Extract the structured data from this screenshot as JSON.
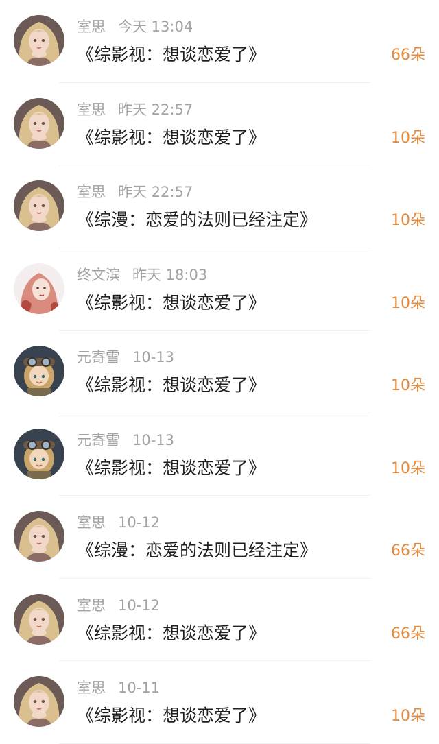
{
  "colors": {
    "meta_text": "#a3a3a3",
    "title_text": "#1f1f1f",
    "count_text": "#e58a3c",
    "divider": "#f0f0f0"
  },
  "avatar_styles": {
    "blonde-girl-avatar": {
      "bg": "#6b5a55",
      "hair": "#d9c08e",
      "face": "#f2d8c8",
      "accent": "#8b6d66"
    },
    "pink-girl-avatar": {
      "bg": "#f5eeee",
      "hair": "#d98b7e",
      "face": "#f6e1d7",
      "accent": "#b44a3f"
    },
    "aviator-chibi-avatar": {
      "bg": "#39424f",
      "hair": "#c9a56a",
      "face": "#f1d8bd",
      "accent": "#6f5a45"
    }
  },
  "items": [
    {
      "avatar": "blonde-girl-avatar",
      "name": "室思",
      "time": "今天 13:04",
      "title": "《综影视：想谈恋爱了》",
      "count": "66朵"
    },
    {
      "avatar": "blonde-girl-avatar",
      "name": "室思",
      "time": "昨天 22:57",
      "title": "《综影视：想谈恋爱了》",
      "count": "10朵"
    },
    {
      "avatar": "blonde-girl-avatar",
      "name": "室思",
      "time": "昨天 22:57",
      "title": "《综漫：恋爱的法则已经注定》",
      "count": "10朵"
    },
    {
      "avatar": "pink-girl-avatar",
      "name": "终文滨",
      "time": "昨天 18:03",
      "title": "《综影视：想谈恋爱了》",
      "count": "10朵"
    },
    {
      "avatar": "aviator-chibi-avatar",
      "name": "元寄雪",
      "time": "10-13",
      "title": "《综影视：想谈恋爱了》",
      "count": "10朵"
    },
    {
      "avatar": "aviator-chibi-avatar",
      "name": "元寄雪",
      "time": "10-13",
      "title": "《综影视：想谈恋爱了》",
      "count": "10朵"
    },
    {
      "avatar": "blonde-girl-avatar",
      "name": "室思",
      "time": "10-12",
      "title": "《综漫：恋爱的法则已经注定》",
      "count": "66朵"
    },
    {
      "avatar": "blonde-girl-avatar",
      "name": "室思",
      "time": "10-12",
      "title": "《综影视：想谈恋爱了》",
      "count": "66朵"
    },
    {
      "avatar": "blonde-girl-avatar",
      "name": "室思",
      "time": "10-11",
      "title": "《综影视：想谈恋爱了》",
      "count": "10朵"
    }
  ]
}
